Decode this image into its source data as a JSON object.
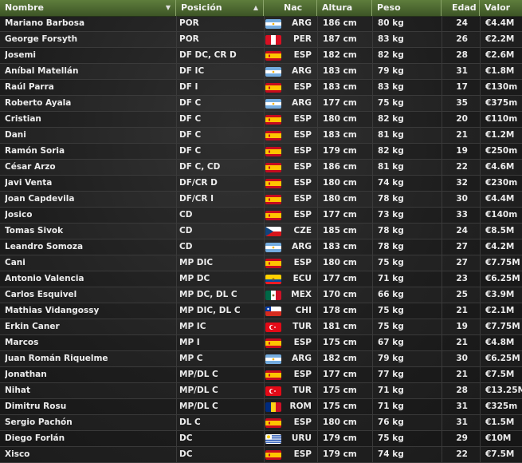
{
  "headers": {
    "nombre": "Nombre",
    "posicion": "Posición",
    "nac": "Nac",
    "altura": "Altura",
    "peso": "Peso",
    "edad": "Edad",
    "valor": "Valor"
  },
  "colors": {
    "header_top": "#5e7d3c",
    "header_bottom": "#3d5526",
    "row_line": "#3a3a3a"
  },
  "players": [
    {
      "nombre": "Mariano Barbosa",
      "posicion": "POR",
      "flag": "argentina-flag-icon",
      "nac": "ARG",
      "altura": "186 cm",
      "peso": "80 kg",
      "edad": "24",
      "valor": "€4.4M"
    },
    {
      "nombre": "George Forsyth",
      "posicion": "POR",
      "flag": "peru-flag-icon",
      "nac": "PER",
      "altura": "187 cm",
      "peso": "83 kg",
      "edad": "26",
      "valor": "€2.2M"
    },
    {
      "nombre": "Josemi",
      "posicion": "DF DC, CR D",
      "flag": "spain-flag-icon",
      "nac": "ESP",
      "altura": "182 cm",
      "peso": "82 kg",
      "edad": "28",
      "valor": "€2.6M"
    },
    {
      "nombre": "Aníbal Matellán",
      "posicion": "DF IC",
      "flag": "argentina-flag-icon",
      "nac": "ARG",
      "altura": "183 cm",
      "peso": "79 kg",
      "edad": "31",
      "valor": "€1.8M"
    },
    {
      "nombre": "Raúl Parra",
      "posicion": "DF I",
      "flag": "spain-flag-icon",
      "nac": "ESP",
      "altura": "183 cm",
      "peso": "83 kg",
      "edad": "17",
      "valor": "€130m"
    },
    {
      "nombre": "Roberto Ayala",
      "posicion": "DF C",
      "flag": "argentina-flag-icon",
      "nac": "ARG",
      "altura": "177 cm",
      "peso": "75 kg",
      "edad": "35",
      "valor": "€375m"
    },
    {
      "nombre": "Cristian",
      "posicion": "DF C",
      "flag": "spain-flag-icon",
      "nac": "ESP",
      "altura": "180 cm",
      "peso": "82 kg",
      "edad": "20",
      "valor": "€110m"
    },
    {
      "nombre": "Dani",
      "posicion": "DF C",
      "flag": "spain-flag-icon",
      "nac": "ESP",
      "altura": "183 cm",
      "peso": "81 kg",
      "edad": "21",
      "valor": "€1.2M"
    },
    {
      "nombre": "Ramón Soria",
      "posicion": "DF C",
      "flag": "spain-flag-icon",
      "nac": "ESP",
      "altura": "179 cm",
      "peso": "82 kg",
      "edad": "19",
      "valor": "€250m"
    },
    {
      "nombre": "César Arzo",
      "posicion": "DF C, CD",
      "flag": "spain-flag-icon",
      "nac": "ESP",
      "altura": "186 cm",
      "peso": "81 kg",
      "edad": "22",
      "valor": "€4.6M"
    },
    {
      "nombre": "Javi Venta",
      "posicion": "DF/CR D",
      "flag": "spain-flag-icon",
      "nac": "ESP",
      "altura": "180 cm",
      "peso": "74 kg",
      "edad": "32",
      "valor": "€230m"
    },
    {
      "nombre": "Joan Capdevila",
      "posicion": "DF/CR I",
      "flag": "spain-flag-icon",
      "nac": "ESP",
      "altura": "180 cm",
      "peso": "78 kg",
      "edad": "30",
      "valor": "€4.4M"
    },
    {
      "nombre": "Josico",
      "posicion": "CD",
      "flag": "spain-flag-icon",
      "nac": "ESP",
      "altura": "177 cm",
      "peso": "73 kg",
      "edad": "33",
      "valor": "€140m"
    },
    {
      "nombre": "Tomas Sivok",
      "posicion": "CD",
      "flag": "czech-flag-icon",
      "nac": "CZE",
      "altura": "185 cm",
      "peso": "78 kg",
      "edad": "24",
      "valor": "€8.5M"
    },
    {
      "nombre": "Leandro Somoza",
      "posicion": "CD",
      "flag": "argentina-flag-icon",
      "nac": "ARG",
      "altura": "183 cm",
      "peso": "78 kg",
      "edad": "27",
      "valor": "€4.2M"
    },
    {
      "nombre": "Cani",
      "posicion": "MP DIC",
      "flag": "spain-flag-icon",
      "nac": "ESP",
      "altura": "180 cm",
      "peso": "75 kg",
      "edad": "27",
      "valor": "€7.75M"
    },
    {
      "nombre": "Antonio Valencia",
      "posicion": "MP DC",
      "flag": "ecuador-flag-icon",
      "nac": "ECU",
      "altura": "177 cm",
      "peso": "71 kg",
      "edad": "23",
      "valor": "€6.25M"
    },
    {
      "nombre": "Carlos Esquivel",
      "posicion": "MP DC, DL C",
      "flag": "mexico-flag-icon",
      "nac": "MEX",
      "altura": "170 cm",
      "peso": "66 kg",
      "edad": "25",
      "valor": "€3.9M"
    },
    {
      "nombre": "Mathias Vidangossy",
      "posicion": "MP DIC, DL C",
      "flag": "chile-flag-icon",
      "nac": "CHI",
      "altura": "178 cm",
      "peso": "75 kg",
      "edad": "21",
      "valor": "€2.1M"
    },
    {
      "nombre": "Erkin Caner",
      "posicion": "MP IC",
      "flag": "turkey-flag-icon",
      "nac": "TUR",
      "altura": "181 cm",
      "peso": "75 kg",
      "edad": "19",
      "valor": "€7.75M"
    },
    {
      "nombre": "Marcos",
      "posicion": "MP I",
      "flag": "spain-flag-icon",
      "nac": "ESP",
      "altura": "175 cm",
      "peso": "67 kg",
      "edad": "21",
      "valor": "€4.8M"
    },
    {
      "nombre": "Juan Román Riquelme",
      "posicion": "MP C",
      "flag": "argentina-flag-icon",
      "nac": "ARG",
      "altura": "182 cm",
      "peso": "79 kg",
      "edad": "30",
      "valor": "€6.25M"
    },
    {
      "nombre": "Jonathan",
      "posicion": "MP/DL C",
      "flag": "spain-flag-icon",
      "nac": "ESP",
      "altura": "177 cm",
      "peso": "77 kg",
      "edad": "21",
      "valor": "€7.5M"
    },
    {
      "nombre": "Nihat",
      "posicion": "MP/DL C",
      "flag": "turkey-flag-icon",
      "nac": "TUR",
      "altura": "175 cm",
      "peso": "71 kg",
      "edad": "28",
      "valor": "€13.25M"
    },
    {
      "nombre": "Dimitru Rosu",
      "posicion": "MP/DL C",
      "flag": "romania-flag-icon",
      "nac": "ROM",
      "altura": "175 cm",
      "peso": "71 kg",
      "edad": "31",
      "valor": "€325m"
    },
    {
      "nombre": "Sergio Pachón",
      "posicion": "DL C",
      "flag": "spain-flag-icon",
      "nac": "ESP",
      "altura": "180 cm",
      "peso": "76 kg",
      "edad": "31",
      "valor": "€1.5M"
    },
    {
      "nombre": "Diego Forlán",
      "posicion": "DC",
      "flag": "uruguay-flag-icon",
      "nac": "URU",
      "altura": "179 cm",
      "peso": "75 kg",
      "edad": "29",
      "valor": "€10M"
    },
    {
      "nombre": "Xisco",
      "posicion": "DC",
      "flag": "spain-flag-icon",
      "nac": "ESP",
      "altura": "179 cm",
      "peso": "74 kg",
      "edad": "22",
      "valor": "€7.5M"
    }
  ]
}
